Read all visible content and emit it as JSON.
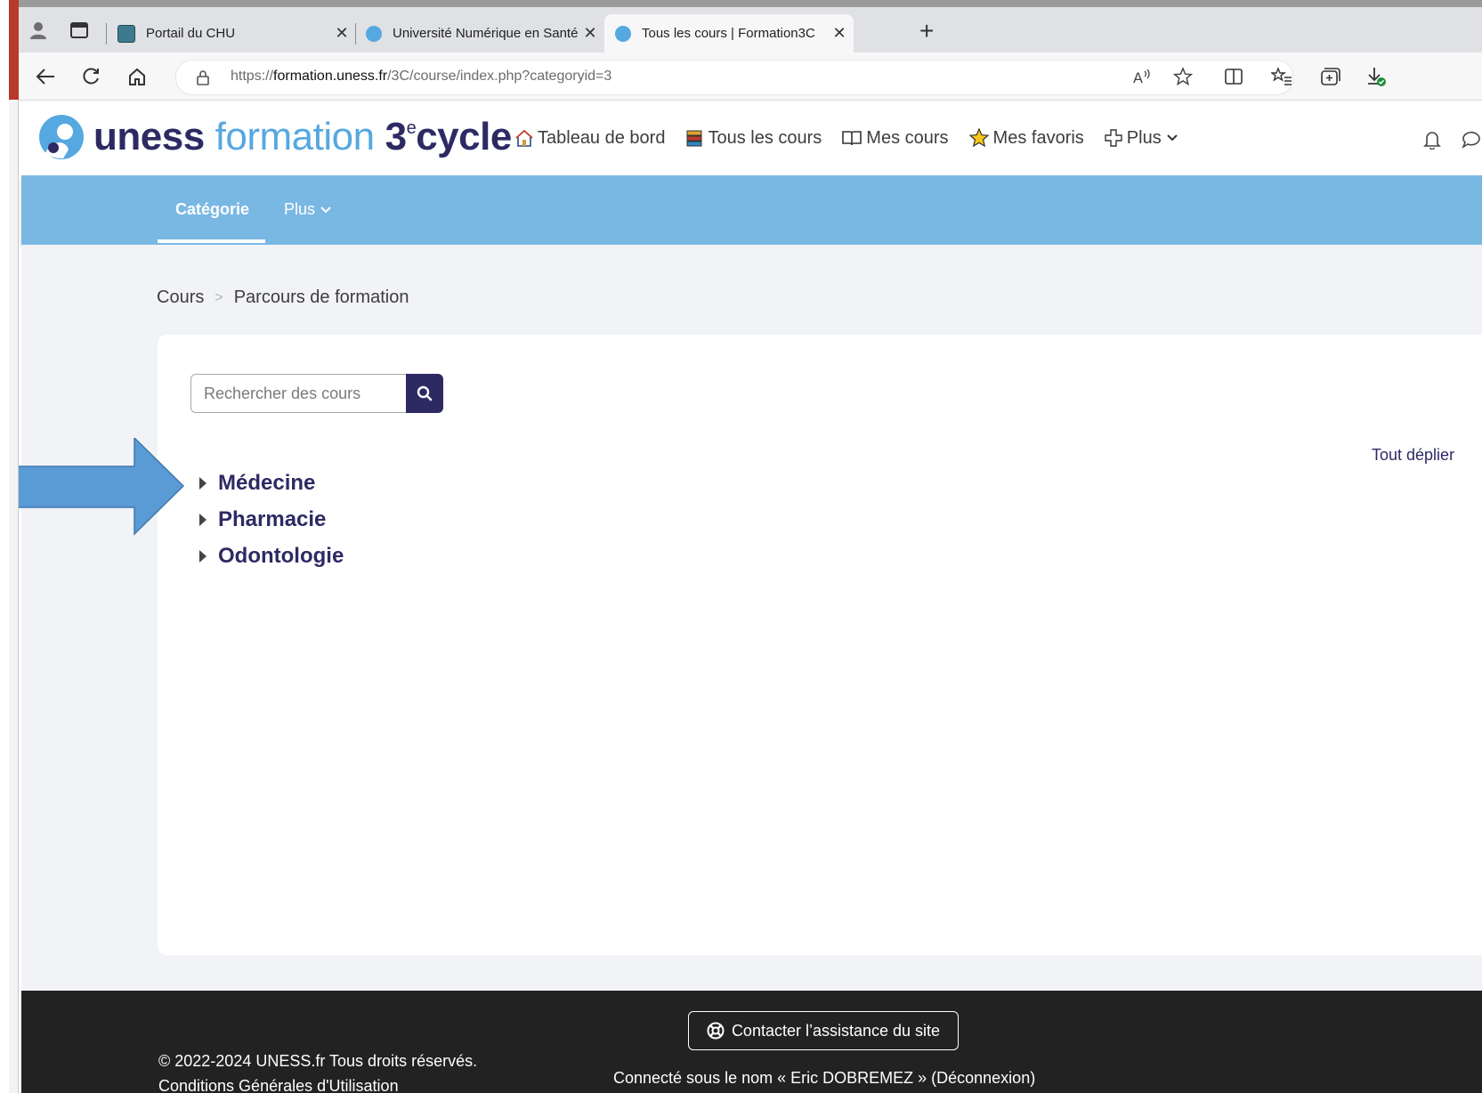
{
  "browser": {
    "tabs": [
      {
        "title": "Portail du CHU",
        "active": false
      },
      {
        "title": "Université Numérique en Santé et",
        "active": false
      },
      {
        "title": "Tous les cours | Formation3C",
        "active": true
      }
    ],
    "url_prefix": "https://",
    "url_host": "formation.uness.fr",
    "url_path": "/3C/course/index.php?categoryid=3"
  },
  "header": {
    "logo": {
      "part1": "uness",
      "part2": "formation",
      "part3": "3",
      "part3_sup": "e",
      "part4": "cycle"
    },
    "nav": [
      {
        "label": "Tableau de bord",
        "icon": "home-icon"
      },
      {
        "label": "Tous les cours",
        "icon": "books-icon"
      },
      {
        "label": "Mes cours",
        "icon": "book-open-icon"
      },
      {
        "label": "Mes favoris",
        "icon": "star-icon"
      },
      {
        "label": "Plus",
        "icon": "plus-icon"
      }
    ]
  },
  "subnav": {
    "category": "Catégorie",
    "more": "Plus"
  },
  "breadcrumb": {
    "root": "Cours",
    "current": "Parcours de formation"
  },
  "search": {
    "placeholder": "Rechercher des cours"
  },
  "expand_all": "Tout déplier",
  "categories": [
    "Médecine",
    "Pharmacie",
    "Odontologie"
  ],
  "footer": {
    "contact": "Contacter l’assistance du site",
    "copyright": "© 2022-2024 UNESS.fr Tous droits réservés.",
    "cgu": "Conditions Générales d'Utilisation",
    "logged_in": "Connecté sous le nom « Eric DOBREMEZ » (Déconnexion)"
  },
  "colors": {
    "brand_dark": "#2d2a63",
    "brand_light": "#56a8e0",
    "subnav": "#7ab8e4",
    "annotation_arrow": "#5b9bd5"
  }
}
